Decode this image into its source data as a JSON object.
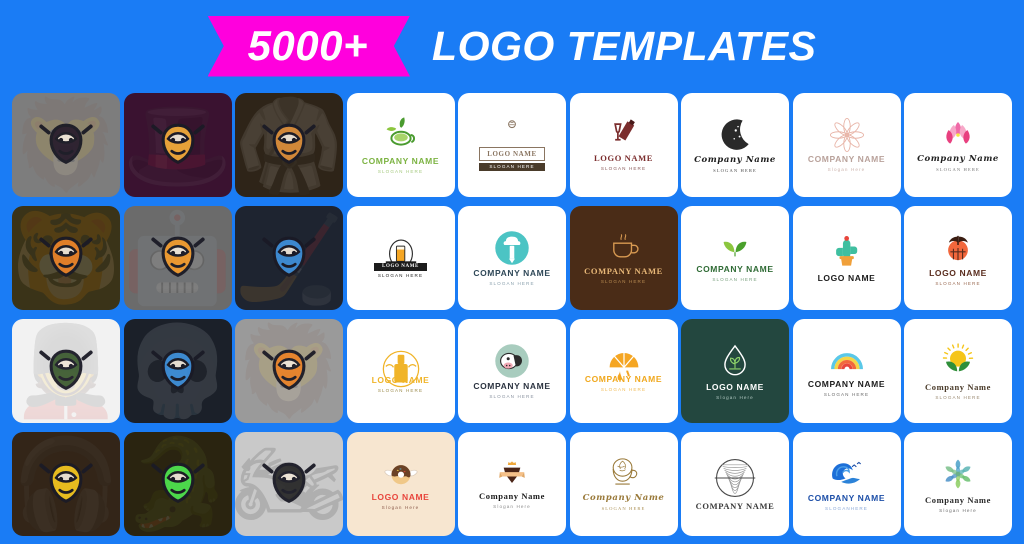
{
  "header": {
    "badge_count": "5000+",
    "title": "LOGO TEMPLATES",
    "badge_color": "#ff00dd",
    "background_color": "#1a7cf5",
    "title_color": "#ffffff"
  },
  "grid": {
    "columns": 9,
    "rows": 4,
    "cards": [
      {
        "id": "r1c1",
        "kind": "mascot",
        "icon": "armored-knight-mascot-icon",
        "bg": "#7d7d7d",
        "glyph": "🦁",
        "art_color": "#2b1f2e",
        "bg_glyph": "🦁"
      },
      {
        "id": "r1c2",
        "kind": "mascot",
        "icon": "top-hat-magician-mascot-icon",
        "bg": "#3a1230",
        "glyph": "🎩",
        "art_color": "#f0a93a",
        "bg_glyph": "🎩"
      },
      {
        "id": "r1c3",
        "kind": "mascot",
        "icon": "bald-monk-mascot-icon",
        "bg": "#2e2418",
        "glyph": "🧑",
        "art_color": "#d98c3a",
        "bg_glyph": "🥋"
      },
      {
        "id": "r1c4",
        "kind": "logo",
        "icon": "green-tea-cup-icon",
        "bg": "#ffffff",
        "name": "COMPANY NAME",
        "slogan": "SLOGAN HERE",
        "name_color": "#7cb342",
        "slogan_color": "#a5c97e",
        "font": "sans",
        "mark": "tea"
      },
      {
        "id": "r1c5",
        "kind": "logo",
        "icon": "bakery-badge-icon",
        "bg": "#ffffff",
        "name": "LOGO NAME",
        "slogan": "SLOGAN HERE",
        "name_color": "#8a7561",
        "slogan_color": "#ffffff",
        "font": "serif",
        "mark": "badge"
      },
      {
        "id": "r1c6",
        "kind": "logo",
        "icon": "wine-bottle-glass-icon",
        "bg": "#ffffff",
        "name": "LOGO NAME",
        "slogan": "SLOGAN HERE",
        "name_color": "#7b2d2d",
        "slogan_color": "#8a5a5a",
        "font": "serif",
        "mark": "wine"
      },
      {
        "id": "r1c7",
        "kind": "logo",
        "icon": "crescent-moon-icon",
        "bg": "#ffffff",
        "name": "Company Name",
        "slogan": "SLOGAN HERE",
        "name_color": "#1c1c1c",
        "slogan_color": "#4a4a4a",
        "font": "script",
        "mark": "moon"
      },
      {
        "id": "r1c8",
        "kind": "logo",
        "icon": "pink-mandala-flower-icon",
        "bg": "#ffffff",
        "name": "COMPANY NAME",
        "slogan": "Slogan Here",
        "name_color": "#b9a29b",
        "slogan_color": "#cbb2ab",
        "font": "sans",
        "mark": "mandala"
      },
      {
        "id": "r1c9",
        "kind": "logo",
        "icon": "pink-lotus-icon",
        "bg": "#ffffff",
        "name": "Company Name",
        "slogan": "SLOGAN HERE",
        "name_color": "#222222",
        "slogan_color": "#777777",
        "font": "script",
        "mark": "lotus"
      },
      {
        "id": "r2c1",
        "kind": "mascot",
        "icon": "tiger-soldier-mascot-icon",
        "bg": "#3a3318",
        "glyph": "🐯",
        "art_color": "#e8832a",
        "bg_glyph": "🐯"
      },
      {
        "id": "r2c2",
        "kind": "mascot",
        "icon": "robot-spider-mascot-icon",
        "bg": "#6b6b6b",
        "glyph": "🕷",
        "art_color": "#f09a2e",
        "bg_glyph": "🤖"
      },
      {
        "id": "r2c3",
        "kind": "mascot",
        "icon": "hockey-player-mascot-icon",
        "bg": "#1e2430",
        "glyph": "🏒",
        "art_color": "#3f8fd8",
        "bg_glyph": "🏒"
      },
      {
        "id": "r2c4",
        "kind": "logo",
        "icon": "beer-glass-crest-icon",
        "bg": "#ffffff",
        "name": "LOGO NAME",
        "slogan": "SLOGAN HERE",
        "name_color": "#ffffff",
        "slogan_color": "#1c1c1c",
        "font": "serif",
        "mark": "beer"
      },
      {
        "id": "r2c5",
        "kind": "logo",
        "icon": "chef-hat-fork-icon",
        "bg": "#ffffff",
        "name": "COMPANY NAME",
        "slogan": "SLOGAN HERE",
        "name_color": "#2f4858",
        "slogan_color": "#8aa0ad",
        "font": "sans",
        "mark": "chef"
      },
      {
        "id": "r2c6",
        "kind": "logo",
        "icon": "coffee-cup-icon",
        "bg": "#4a2c17",
        "name": "COMPANY NAME",
        "slogan": "SLOGAN HERE",
        "name_color": "#e8b878",
        "slogan_color": "#b98c52",
        "font": "serif",
        "mark": "coffee"
      },
      {
        "id": "r2c7",
        "kind": "logo",
        "icon": "green-leaves-icon",
        "bg": "#ffffff",
        "name": "COMPANY NAME",
        "slogan": "SLOGAN HERE",
        "name_color": "#2f6b35",
        "slogan_color": "#7aa07e",
        "font": "sans",
        "mark": "leaves"
      },
      {
        "id": "r2c8",
        "kind": "logo",
        "icon": "cactus-pot-icon",
        "bg": "#ffffff",
        "name": "LOGO  NAME",
        "slogan": "",
        "name_color": "#1c1c1c",
        "slogan_color": "#888888",
        "font": "sans",
        "mark": "cactus"
      },
      {
        "id": "r2c9",
        "kind": "logo",
        "icon": "palm-tree-sunset-icon",
        "bg": "#ffffff",
        "name": "LOGO  NAME",
        "slogan": "SLOGAN HERE",
        "name_color": "#5a2d1e",
        "slogan_color": "#9a6a52",
        "font": "sans",
        "mark": "palm"
      },
      {
        "id": "r3c1",
        "kind": "mascot",
        "icon": "army-soldier-mascot-icon",
        "bg": "#f2f2f2",
        "glyph": "💂",
        "art_color": "#3e5c32",
        "bg_glyph": "💂"
      },
      {
        "id": "r3c2",
        "kind": "mascot",
        "icon": "cowboy-skull-mascot-icon",
        "bg": "#1b2029",
        "glyph": "🤠",
        "art_color": "#3f8fd8",
        "bg_glyph": "💀"
      },
      {
        "id": "r3c3",
        "kind": "mascot",
        "icon": "battle-axe-mascot-icon",
        "bg": "#9a9a9a",
        "glyph": "🪓",
        "art_color": "#e8832a",
        "bg_glyph": "🦁"
      },
      {
        "id": "r3c4",
        "kind": "logo",
        "icon": "beer-bottle-wreath-icon",
        "bg": "#ffffff",
        "name": "LOGO NAME",
        "slogan": "SLOGAN HERE",
        "name_color": "#f0b429",
        "slogan_color": "#9a8a4a",
        "font": "sans",
        "mark": "bottle"
      },
      {
        "id": "r3c5",
        "kind": "logo",
        "icon": "dairy-cow-icon",
        "bg": "#ffffff",
        "name": "COMPANY NAME",
        "slogan": "SLOGAN HERE",
        "name_color": "#2b3340",
        "slogan_color": "#8a93a0",
        "font": "sans",
        "mark": "cow"
      },
      {
        "id": "r3c6",
        "kind": "logo",
        "icon": "orange-slice-drip-icon",
        "bg": "#ffffff",
        "name": "COMPANY NAME",
        "slogan": "SLOGAN HERE",
        "name_color": "#f0a81e",
        "slogan_color": "#f0bb55",
        "font": "sans",
        "mark": "orange"
      },
      {
        "id": "r3c7",
        "kind": "logo",
        "icon": "water-drop-sprout-icon",
        "bg": "#23473f",
        "name": "LOGO NAME",
        "slogan": "Slogan Here",
        "name_color": "#ffffff",
        "slogan_color": "#b5ccc5",
        "font": "sans",
        "mark": "drop"
      },
      {
        "id": "r3c8",
        "kind": "logo",
        "icon": "rainbow-icon",
        "bg": "#ffffff",
        "name": "COMPANY NAME",
        "slogan": "SLOGAN HERE",
        "name_color": "#1c1c1c",
        "slogan_color": "#6a6a6a",
        "font": "sans",
        "mark": "rainbow"
      },
      {
        "id": "r3c9",
        "kind": "logo",
        "icon": "sunrise-leaves-icon",
        "bg": "#ffffff",
        "name": "Company Name",
        "slogan": "SLOGAN HERE",
        "name_color": "#4a3b2a",
        "slogan_color": "#9a8a72",
        "font": "serif",
        "mark": "sunrise"
      },
      {
        "id": "r4c1",
        "kind": "mascot",
        "icon": "headphone-skull-mascot-icon",
        "bg": "#332518",
        "glyph": "💀",
        "art_color": "#f0c420",
        "bg_glyph": "🎧"
      },
      {
        "id": "r4c2",
        "kind": "mascot",
        "icon": "crocodile-shield-mascot-icon",
        "bg": "#2a2410",
        "glyph": "🐊",
        "art_color": "#4ee04e",
        "bg_glyph": "🐊"
      },
      {
        "id": "r4c3",
        "kind": "mascot",
        "icon": "motorcycle-rider-mascot-icon",
        "bg": "#c9c9c9",
        "glyph": "🏍",
        "art_color": "#2b2b2b",
        "bg_glyph": "🏍"
      },
      {
        "id": "r4c4",
        "kind": "logo",
        "icon": "winged-donut-icon",
        "bg": "#f7e6d0",
        "name": "LOGO NAME",
        "slogan": "Slogan Here",
        "name_color": "#e8453c",
        "slogan_color": "#8a5a4a",
        "font": "sans",
        "mark": "donut"
      },
      {
        "id": "r4c5",
        "kind": "logo",
        "icon": "chocolate-cake-crown-icon",
        "bg": "#ffffff",
        "name": "Company Name",
        "slogan": "Slogan Here",
        "name_color": "#1c1c1c",
        "slogan_color": "#8a8a8a",
        "font": "serif",
        "mark": "cake"
      },
      {
        "id": "r4c6",
        "kind": "logo",
        "icon": "latte-art-cup-icon",
        "bg": "#ffffff",
        "name": "Company Name",
        "slogan": "SLOGAN HERE",
        "name_color": "#9a7a3a",
        "slogan_color": "#ab9055",
        "font": "script",
        "mark": "latte"
      },
      {
        "id": "r4c7",
        "kind": "logo",
        "icon": "vintage-circle-badge-icon",
        "bg": "#ffffff",
        "name": "COMPANY NAME",
        "slogan": "",
        "name_color": "#3a3a3a",
        "slogan_color": "#8a8a8a",
        "font": "serif",
        "mark": "circle"
      },
      {
        "id": "r4c8",
        "kind": "logo",
        "icon": "ocean-wave-birds-icon",
        "bg": "#ffffff",
        "name": "COMPANY NAME",
        "slogan": "SLOGANHERE",
        "name_color": "#1d4fa8",
        "slogan_color": "#8aa8d8",
        "font": "sans",
        "mark": "wave"
      },
      {
        "id": "r4c9",
        "kind": "logo",
        "icon": "ornamental-leaf-pattern-icon",
        "bg": "#ffffff",
        "name": "Company Name",
        "slogan": "Slogan Here",
        "name_color": "#2b2b2b",
        "slogan_color": "#6a6a6a",
        "font": "serif",
        "mark": "ornament"
      }
    ]
  }
}
